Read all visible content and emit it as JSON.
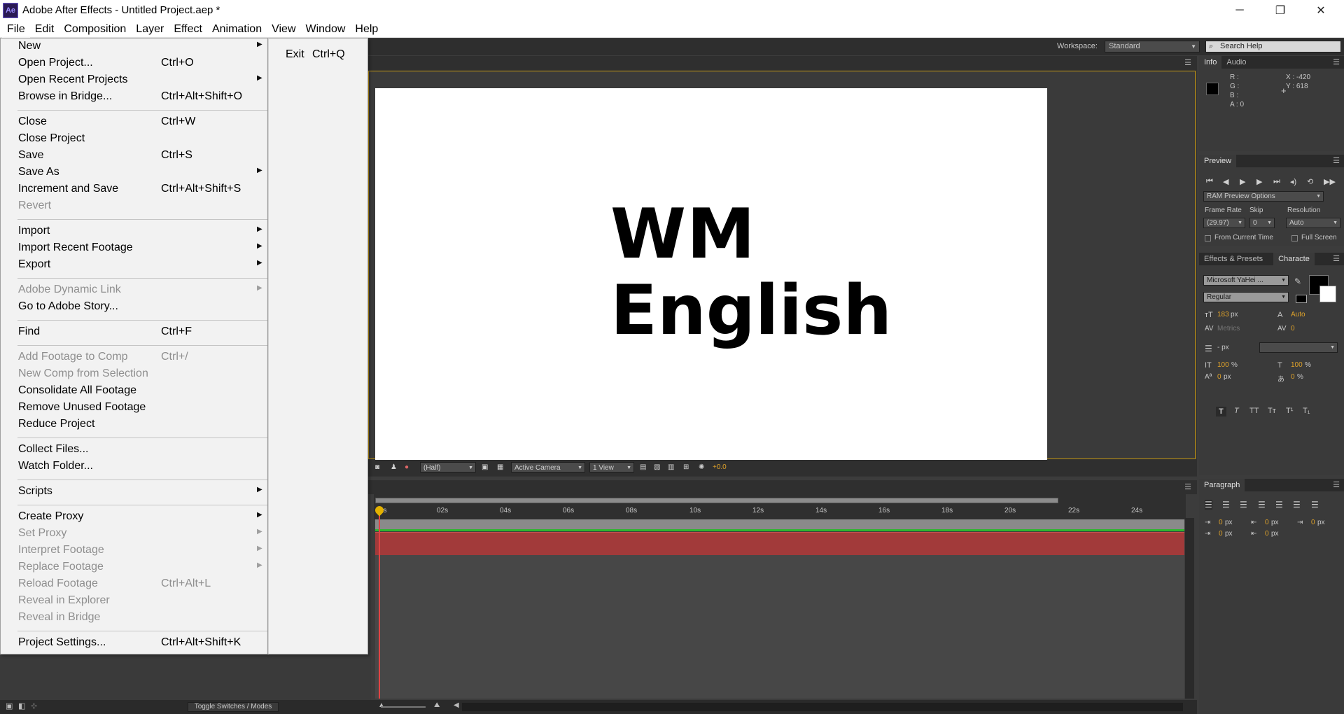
{
  "window": {
    "title": "Adobe After Effects - Untitled Project.aep *",
    "logo": "Ae",
    "minimize": "─",
    "restore": "❐",
    "close": "✕"
  },
  "menubar": [
    "File",
    "Edit",
    "Composition",
    "Layer",
    "Effect",
    "Animation",
    "View",
    "Window",
    "Help"
  ],
  "workspace": {
    "label": "Workspace:",
    "value": "Standard",
    "search_placeholder": "Search Help"
  },
  "file_menu": {
    "items": [
      {
        "label": "New",
        "shortcut": "",
        "submenu": true,
        "disabled": false
      },
      {
        "label": "Open Project...",
        "shortcut": "Ctrl+O",
        "submenu": false,
        "disabled": false
      },
      {
        "label": "Open Recent Projects",
        "shortcut": "",
        "submenu": true,
        "disabled": false
      },
      {
        "label": "Browse in Bridge...",
        "shortcut": "Ctrl+Alt+Shift+O",
        "submenu": false,
        "disabled": false
      },
      {
        "label": "Close",
        "shortcut": "Ctrl+W",
        "submenu": false,
        "disabled": false
      },
      {
        "label": "Close Project",
        "shortcut": "",
        "submenu": false,
        "disabled": false
      },
      {
        "label": "Save",
        "shortcut": "Ctrl+S",
        "submenu": false,
        "disabled": false
      },
      {
        "label": "Save As",
        "shortcut": "",
        "submenu": true,
        "disabled": false
      },
      {
        "label": "Increment and Save",
        "shortcut": "Ctrl+Alt+Shift+S",
        "submenu": false,
        "disabled": false
      },
      {
        "label": "Revert",
        "shortcut": "",
        "submenu": false,
        "disabled": true
      },
      {
        "label": "Import",
        "shortcut": "",
        "submenu": true,
        "disabled": false
      },
      {
        "label": "Import Recent Footage",
        "shortcut": "",
        "submenu": true,
        "disabled": false
      },
      {
        "label": "Export",
        "shortcut": "",
        "submenu": true,
        "disabled": false
      },
      {
        "label": "Adobe Dynamic Link",
        "shortcut": "",
        "submenu": true,
        "disabled": true
      },
      {
        "label": "Go to Adobe Story...",
        "shortcut": "",
        "submenu": false,
        "disabled": false
      },
      {
        "label": "Find",
        "shortcut": "Ctrl+F",
        "submenu": false,
        "disabled": false
      },
      {
        "label": "Add Footage to Comp",
        "shortcut": "Ctrl+/",
        "submenu": false,
        "disabled": true
      },
      {
        "label": "New Comp from Selection",
        "shortcut": "",
        "submenu": false,
        "disabled": true
      },
      {
        "label": "Consolidate All Footage",
        "shortcut": "",
        "submenu": false,
        "disabled": false
      },
      {
        "label": "Remove Unused Footage",
        "shortcut": "",
        "submenu": false,
        "disabled": false
      },
      {
        "label": "Reduce Project",
        "shortcut": "",
        "submenu": false,
        "disabled": false
      },
      {
        "label": "Collect Files...",
        "shortcut": "",
        "submenu": false,
        "disabled": false
      },
      {
        "label": "Watch Folder...",
        "shortcut": "",
        "submenu": false,
        "disabled": false
      },
      {
        "label": "Scripts",
        "shortcut": "",
        "submenu": true,
        "disabled": false
      },
      {
        "label": "Create Proxy",
        "shortcut": "",
        "submenu": true,
        "disabled": false
      },
      {
        "label": "Set Proxy",
        "shortcut": "",
        "submenu": true,
        "disabled": true
      },
      {
        "label": "Interpret Footage",
        "shortcut": "",
        "submenu": true,
        "disabled": true
      },
      {
        "label": "Replace Footage",
        "shortcut": "",
        "submenu": true,
        "disabled": true
      },
      {
        "label": "Reload Footage",
        "shortcut": "Ctrl+Alt+L",
        "submenu": false,
        "disabled": true
      },
      {
        "label": "Reveal in Explorer",
        "shortcut": "",
        "submenu": false,
        "disabled": true
      },
      {
        "label": "Reveal in Bridge",
        "shortcut": "",
        "submenu": false,
        "disabled": true
      },
      {
        "label": "Project Settings...",
        "shortcut": "Ctrl+Alt+Shift+K",
        "submenu": false,
        "disabled": false
      }
    ],
    "submenu_item": {
      "label": "Exit",
      "shortcut": "Ctrl+Q"
    }
  },
  "composition": {
    "text_line1": "WM",
    "text_line2": "English",
    "footer": {
      "resolution": "(Half)",
      "camera": "Active Camera",
      "views": "1 View",
      "exposure": "+0.0"
    }
  },
  "timeline": {
    "ticks": [
      "0s",
      "02s",
      "04s",
      "06s",
      "08s",
      "10s",
      "12s",
      "14s",
      "16s",
      "18s",
      "20s",
      "22s",
      "24s"
    ],
    "toggle_label": "Toggle Switches / Modes"
  },
  "info_panel": {
    "tabs": [
      "Info",
      "Audio"
    ],
    "r": "R :",
    "g": "G :",
    "b": "B :",
    "a": "A : 0",
    "x": "X : -420",
    "y": "Y : 618"
  },
  "preview_panel": {
    "tab": "Preview",
    "ram_options": "RAM Preview Options",
    "frame_rate_label": "Frame Rate",
    "skip_label": "Skip",
    "resolution_label": "Resolution",
    "frame_rate": "(29.97)",
    "skip": "0",
    "resolution": "Auto",
    "from_current": "From Current Time",
    "full_screen": "Full Screen"
  },
  "character_panel": {
    "tabs": [
      "Effects & Presets",
      "Characte"
    ],
    "font": "Microsoft YaHei ...",
    "style": "Regular",
    "size": "183",
    "size_unit": "px",
    "leading": "Auto",
    "kerning": "Metrics",
    "tracking": "0",
    "stroke_unit": "- px",
    "vscale": "100",
    "hscale": "100",
    "pct": "%",
    "baseline": "0",
    "baseline_unit": "px",
    "tsume": "0",
    "tsume_unit": "%"
  },
  "paragraph_panel": {
    "tab": "Paragraph",
    "values": [
      "0",
      "0",
      "0",
      "0",
      "0"
    ],
    "unit": "px"
  },
  "colors": {
    "menu_bg": "#f2f2f2",
    "panel_bg": "#3a3a3a",
    "accent_orange": "#e0a32a",
    "comp_border": "#c29512",
    "layer_red": "#a23a3a",
    "layer_green": "#2fb52f"
  }
}
